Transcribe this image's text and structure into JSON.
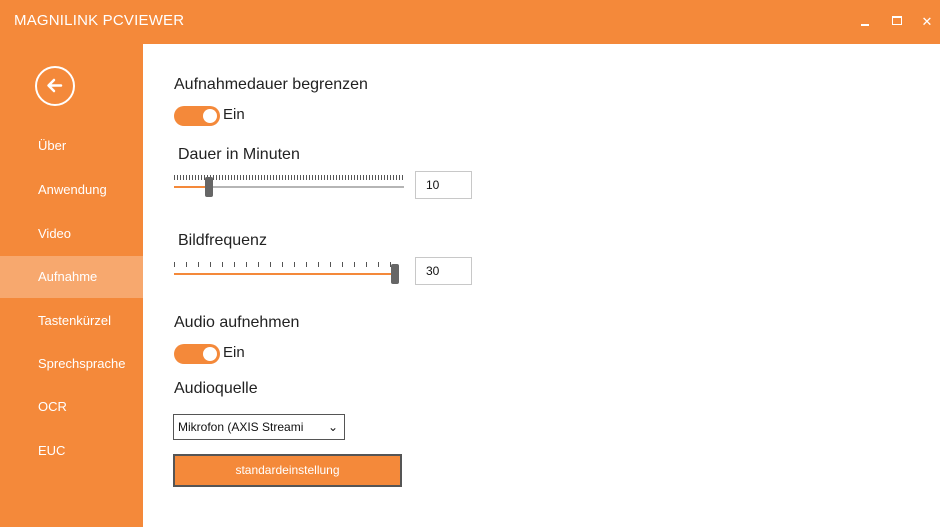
{
  "window": {
    "title": "MAGNILINK PCVIEWER",
    "minimize_icon": "minimize-icon",
    "maximize_icon": "maximize-icon",
    "close_label": "✕"
  },
  "sidebar": {
    "back_icon": "arrow-left-circle-icon",
    "items": [
      {
        "label": "Über",
        "active": false
      },
      {
        "label": "Anwendung",
        "active": false
      },
      {
        "label": "Video",
        "active": false
      },
      {
        "label": "Aufnahme",
        "active": true
      },
      {
        "label": "Tastenkürzel",
        "active": false
      },
      {
        "label": "Sprechsprache",
        "active": false
      },
      {
        "label": "OCR",
        "active": false
      },
      {
        "label": "EUC",
        "active": false
      }
    ]
  },
  "settings": {
    "limit_duration": {
      "label": "Aufnahmedauer begrenzen",
      "state": "Ein",
      "on": true
    },
    "duration": {
      "label": "Dauer in Minuten",
      "value": "10",
      "fraction": 0.15
    },
    "framerate": {
      "label": "Bildfrequenz",
      "value": "30",
      "fraction": 1.0
    },
    "record_audio": {
      "label": "Audio aufnehmen",
      "state": "Ein",
      "on": true
    },
    "audio_source": {
      "label": "Audioquelle",
      "selected": "Mikrofon (AXIS Streami"
    },
    "reset_button": "standardeinstellung"
  },
  "colors": {
    "accent": "#f4893a",
    "sidebar_active": "#f7a86e"
  }
}
